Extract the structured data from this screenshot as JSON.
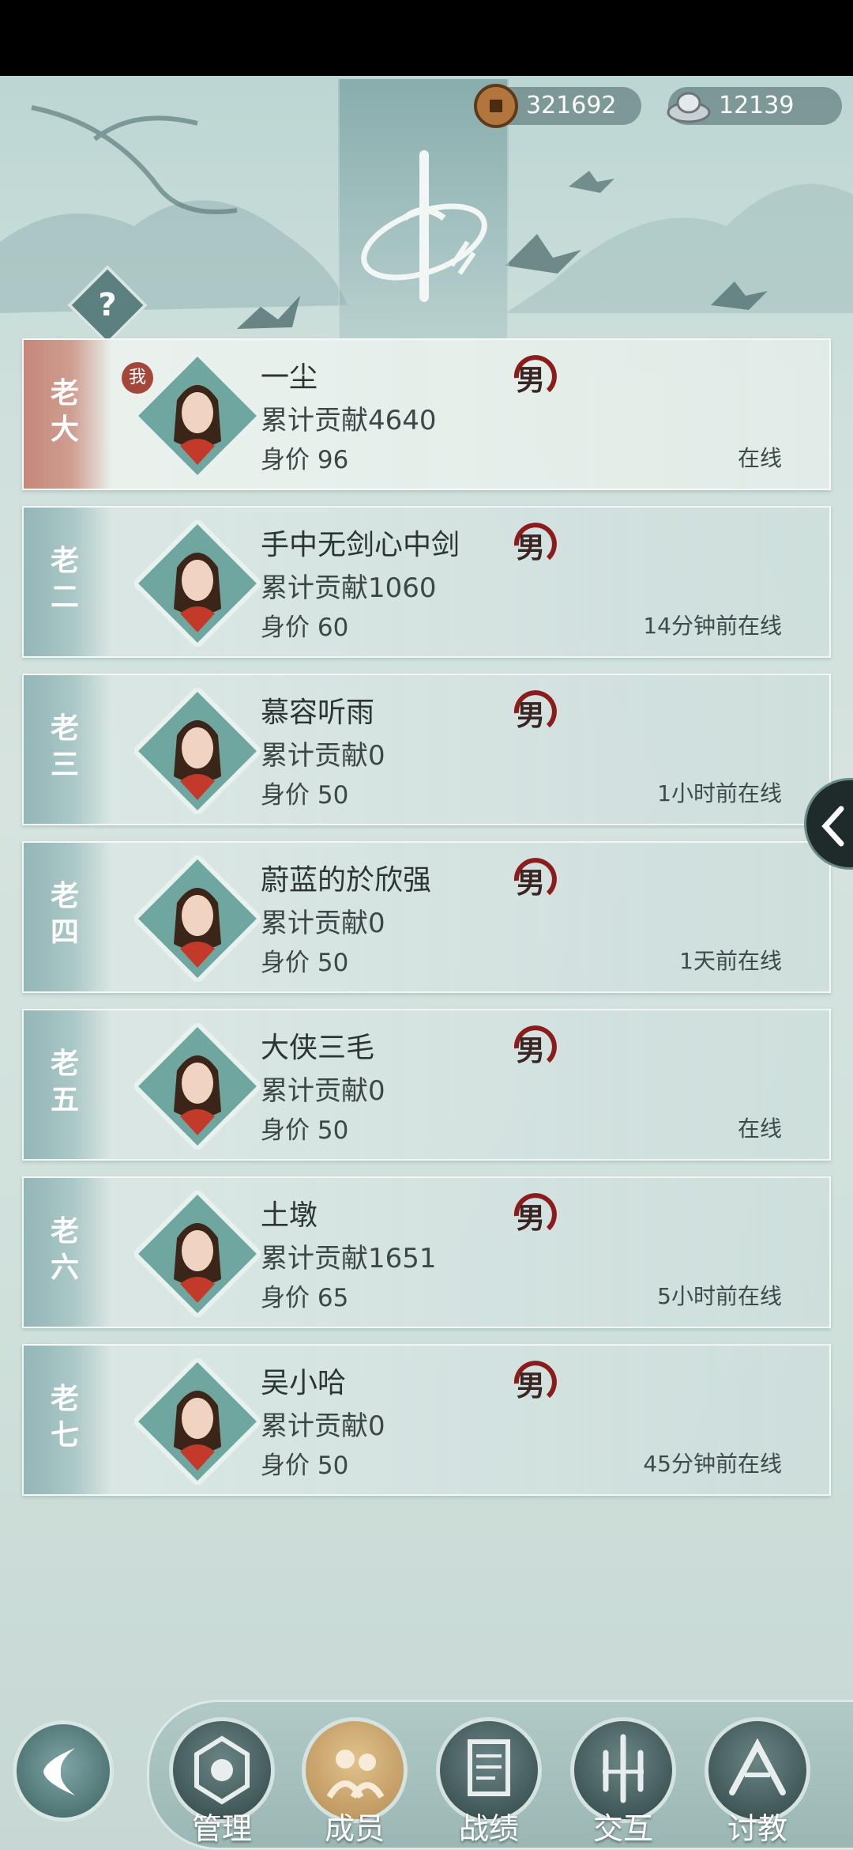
{
  "currency": {
    "copper": "321692",
    "silver": "12139"
  },
  "help": {
    "icon": "?"
  },
  "members": [
    {
      "rank": "老大",
      "name": "一尘",
      "contribution": "累计贡献4640",
      "price": "身价 96",
      "gender": "男",
      "status": "在线",
      "me_badge": "我",
      "selected": true
    },
    {
      "rank": "老二",
      "name": "手中无剑心中剑",
      "contribution": "累计贡献1060",
      "price": "身价 60",
      "gender": "男",
      "status": "14分钟前在线"
    },
    {
      "rank": "老三",
      "name": "慕容听雨",
      "contribution": "累计贡献0",
      "price": "身价 50",
      "gender": "男",
      "status": "1小时前在线"
    },
    {
      "rank": "老四",
      "name": "蔚蓝的於欣强",
      "contribution": "累计贡献0",
      "price": "身价 50",
      "gender": "男",
      "status": "1天前在线"
    },
    {
      "rank": "老五",
      "name": "大侠三毛",
      "contribution": "累计贡献0",
      "price": "身价 50",
      "gender": "男",
      "status": "在线"
    },
    {
      "rank": "老六",
      "name": "土墩",
      "contribution": "累计贡献1651",
      "price": "身价 65",
      "gender": "男",
      "status": "5小时前在线"
    },
    {
      "rank": "老七",
      "name": "吴小哈",
      "contribution": "累计贡献0",
      "price": "身价 50",
      "gender": "男",
      "status": "45分钟前在线"
    }
  ],
  "nav": [
    {
      "label": "管理",
      "icon": "manage-icon"
    },
    {
      "label": "成员",
      "icon": "members-icon",
      "active": true
    },
    {
      "label": "战绩",
      "icon": "record-icon"
    },
    {
      "label": "交互",
      "icon": "interact-icon"
    },
    {
      "label": "讨教",
      "icon": "challenge-icon"
    }
  ],
  "colors": {
    "accent_selected": "#c6877a",
    "rank_bg": "#93b6b6",
    "gender_ring": "#8c1b1b"
  }
}
